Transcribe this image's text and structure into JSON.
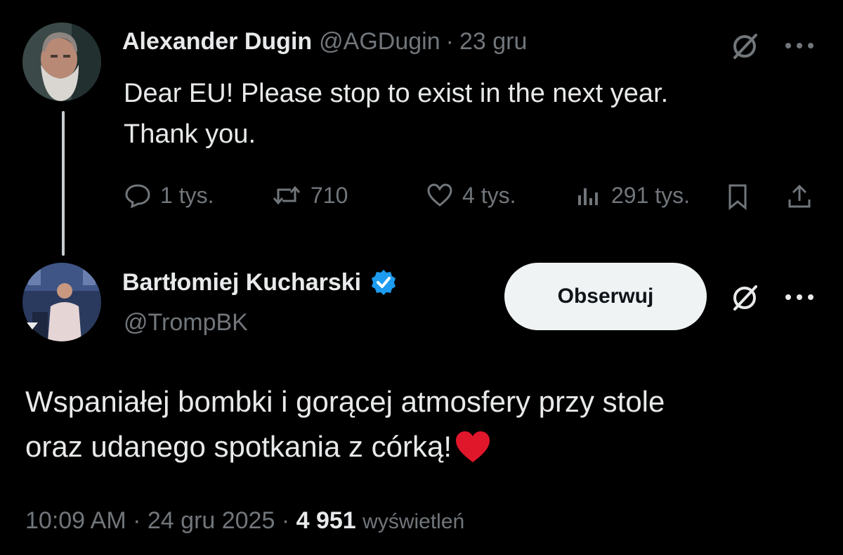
{
  "parent_tweet": {
    "author": {
      "name": "Alexander Dugin",
      "handle": "@AGDugin",
      "separator": "·",
      "date": "23 gru"
    },
    "text_lines": [
      "Dear EU! Please stop to exist in the next year.",
      "Thank you."
    ],
    "actions": {
      "replies": "1 tys.",
      "reposts": "710",
      "likes": "4 tys.",
      "views": "291 tys."
    }
  },
  "reply_tweet": {
    "author": {
      "name": "Bartłomiej Kucharski",
      "handle": "@TrompBK",
      "verified": true
    },
    "follow_label": "Obserwuj",
    "text_lines": [
      "Wspaniałej bombki i gorącej atmosfery przy stole",
      "oraz udanego spotkania z córką!"
    ],
    "emoji": "❤",
    "footer": {
      "time": "10:09 AM",
      "separator": "·",
      "date": "24 gru 2025",
      "separator2": "·",
      "views_count": "4 951",
      "views_label": "wyświetleń"
    }
  },
  "colors": {
    "background": "#000000",
    "text": "#e7e9ea",
    "secondary": "#71767b",
    "verified": "#1d9bf0",
    "heart": "#e0162b",
    "follow_bg": "#eff3f4"
  }
}
